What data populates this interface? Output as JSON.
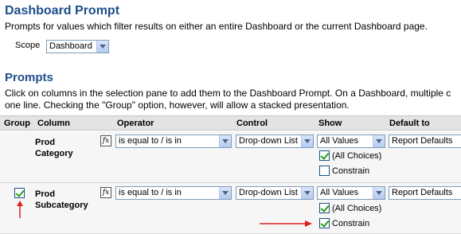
{
  "dashboard": {
    "title": "Dashboard Prompt",
    "description": "Prompts for values which filter results on either an entire Dashboard or the current Dashboard page.",
    "scope_label": "Scope",
    "scope_value": "Dashboard"
  },
  "prompts": {
    "title": "Prompts",
    "description_line1": "Click on columns in the selection pane to add them to the Dashboard Prompt. On a Dashboard, multiple c",
    "description_line2": "one line. Checking the \"Group\" option, however, will allow a stacked presentation."
  },
  "table": {
    "headers": [
      "Group",
      "Column",
      "Operator",
      "Control",
      "Show",
      "Default to"
    ],
    "rows": [
      {
        "column_line1": "Prod",
        "column_line2": "Category",
        "group_checked": false,
        "operator": "is equal to / is in",
        "control": "Drop-down List",
        "show": "All Values",
        "default": "Report Defaults",
        "all_choices_label": "(All Choices)",
        "all_choices_checked": true,
        "constrain_label": "Constrain",
        "constrain_checked": false
      },
      {
        "column_line1": "Prod",
        "column_line2": "Subcategory",
        "group_checked": true,
        "operator": "is equal to / is in",
        "control": "Drop-down List",
        "show": "All Values",
        "default": "Report Defaults",
        "all_choices_label": "(All Choices)",
        "all_choices_checked": true,
        "constrain_label": "Constrain",
        "constrain_checked": true
      }
    ]
  },
  "icons": {
    "formula": "fx-icon",
    "annotation_arrow": "red-arrow-icon"
  },
  "colors": {
    "heading": "#1f4e8a",
    "annotation": "#e02020",
    "check": "#21a121"
  }
}
